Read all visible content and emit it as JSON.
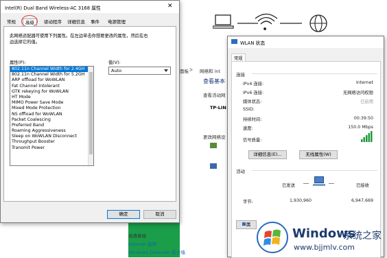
{
  "background": {
    "breadcrumb_a": "面板",
    "breadcrumb_b": "网络和 Int",
    "heading": "查看基本",
    "subheading": "查看活动网",
    "network_name": "TP-LIN",
    "change_settings": "更改网络设",
    "see_also_heading": "另请参阅",
    "internet_options": "Internet 选项",
    "defender": "Windows Defender 防火墙",
    "arrow_left": "ᐸ",
    "arrow_right": "ᐳ"
  },
  "adapter_dialog": {
    "title": "Intel(R) Dual Band Wireless-AC 3168 属性",
    "close_glyph": "✕",
    "tabs": [
      "常规",
      "高级",
      "驱动程序",
      "详细信息",
      "事件",
      "电源管理"
    ],
    "active_tab_index": 1,
    "description_line1": "此网络适配器可使用下列属性。在左边单击你想要更改的属性，然后在右",
    "description_line2": "边选择它的值。",
    "property_label": "属性(P):",
    "value_label": "值(V):",
    "properties": [
      "802.11n Channel Width for 2.4GH",
      "802.11n Channel Width for 5.2GH",
      "ARP offload for WoWLAN",
      "Fat Channel Intolerant",
      "GTK rekeying for WoWLAN",
      "HT Mode",
      "MIMO Power Save Mode",
      "Mixed Mode Protection",
      "NS offload for WoWLAN",
      "Packet Coalescing",
      "Preferred Band",
      "Roaming Aggressiveness",
      "Sleep on WoWLAN Disconnect",
      "Throughput Booster",
      "Transmit Power"
    ],
    "selected_property_index": 0,
    "value": "Auto",
    "ok": "确定",
    "cancel": "取消"
  },
  "wlan_dialog": {
    "title": "WLAN 状态",
    "tab": "常规",
    "connection_heading": "连接",
    "rows": [
      {
        "label": "IPv4 连接:",
        "value": "Internet"
      },
      {
        "label": "IPv6 连接:",
        "value": "无网络访问权限"
      },
      {
        "label": "媒体状态:",
        "value": "已启用"
      },
      {
        "label": "SSID:",
        "value": ""
      },
      {
        "label": "持续时间:",
        "value": "00:39:50"
      },
      {
        "label": "速度:",
        "value": "150.0 Mbps"
      }
    ],
    "signal_label": "信号质量:",
    "details_button": "详细信息(E)...",
    "wireless_button": "无线属性(W)",
    "activity_heading": "活动",
    "sent_label": "已发送",
    "received_label": "已接收",
    "bytes_label": "字节:",
    "bytes_sent": "1,930,960",
    "bytes_received": "6,947,669",
    "properties_button": "属"
  },
  "watermark": {
    "brand": "Windows",
    "site_cn": "系统之家",
    "url": "www.bjjmlv.com"
  },
  "colors": {
    "accent": "#0078d7",
    "green_panel": "#1a9e4a",
    "highlight_circle": "#e04040"
  }
}
